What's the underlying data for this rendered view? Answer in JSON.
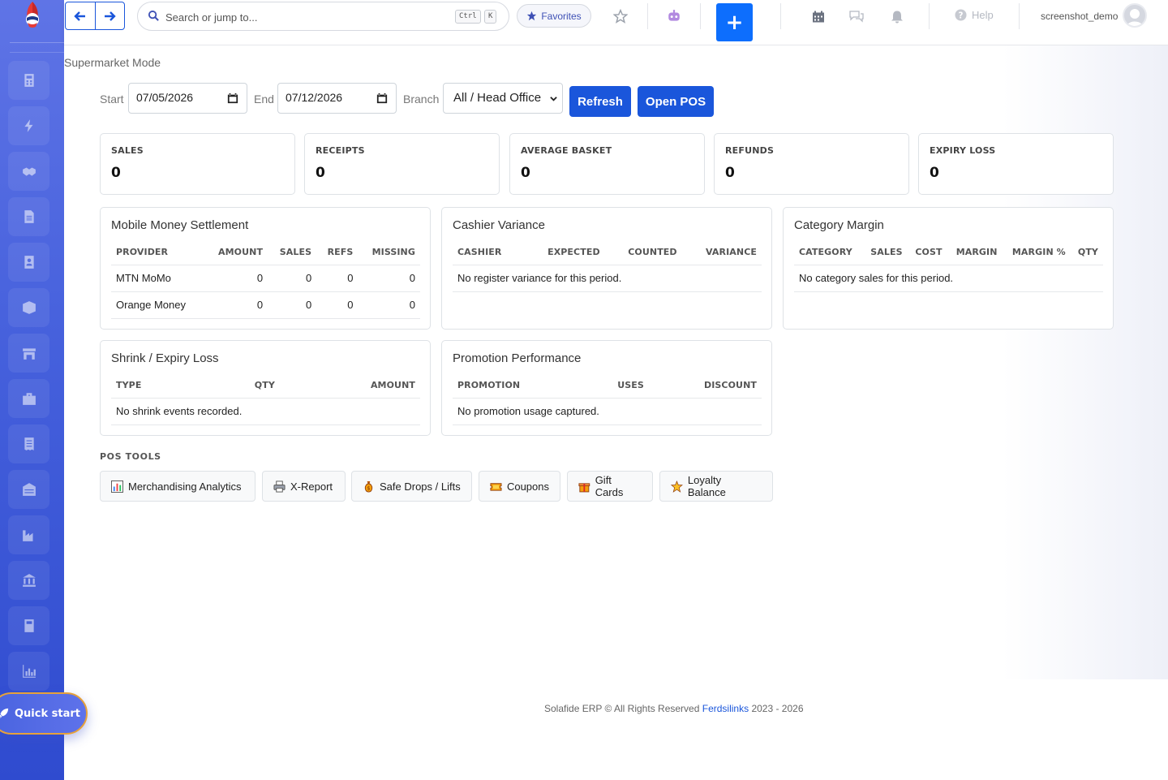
{
  "colors": {
    "primary": "#1a56db",
    "sidebar": "#4560dc",
    "accent_border": "#e6a13a"
  },
  "topbar": {
    "search_placeholder": "Search or jump to...",
    "kbd_ctrl": "Ctrl",
    "kbd_k": "K",
    "favorites_label": "Favorites",
    "plus_label": "+",
    "help_label": "Help",
    "username": "screenshot_demo"
  },
  "sidebar": {
    "items": [
      {
        "icon": "calculator-icon"
      },
      {
        "icon": "bolt-icon"
      },
      {
        "icon": "handshake-icon"
      },
      {
        "icon": "document-icon"
      },
      {
        "icon": "contact-icon"
      },
      {
        "icon": "boxes-icon"
      },
      {
        "icon": "store-icon"
      },
      {
        "icon": "briefcase-icon"
      },
      {
        "icon": "receipt-icon"
      },
      {
        "icon": "warehouse-icon"
      },
      {
        "icon": "factory-icon"
      },
      {
        "icon": "bank-icon"
      },
      {
        "icon": "book-icon"
      },
      {
        "icon": "chart-icon"
      }
    ]
  },
  "page": {
    "title": "Supermarket Mode",
    "filters": {
      "start_label": "Start",
      "start_value": "07/05/2026",
      "end_label": "End",
      "end_value": "07/12/2026",
      "branch_label": "Branch",
      "branch_value": "All / Head Office",
      "refresh_label": "Refresh",
      "open_pos_label": "Open POS"
    },
    "stats": [
      {
        "label": "SALES",
        "value": "0"
      },
      {
        "label": "RECEIPTS",
        "value": "0"
      },
      {
        "label": "AVERAGE BASKET",
        "value": "0"
      },
      {
        "label": "REFUNDS",
        "value": "0"
      },
      {
        "label": "EXPIRY LOSS",
        "value": "0"
      }
    ],
    "mobile_money": {
      "title": "Mobile Money Settlement",
      "headers": [
        "PROVIDER",
        "AMOUNT",
        "SALES",
        "REFS",
        "MISSING"
      ],
      "rows": [
        [
          "MTN MoMo",
          "0",
          "0",
          "0",
          "0"
        ],
        [
          "Orange Money",
          "0",
          "0",
          "0",
          "0"
        ]
      ]
    },
    "cashier_variance": {
      "title": "Cashier Variance",
      "headers": [
        "CASHIER",
        "EXPECTED",
        "COUNTED",
        "VARIANCE"
      ],
      "empty": "No register variance for this period."
    },
    "category_margin": {
      "title": "Category Margin",
      "headers": [
        "CATEGORY",
        "SALES",
        "COST",
        "MARGIN",
        "MARGIN %",
        "QTY"
      ],
      "empty": "No category sales for this period."
    },
    "shrink": {
      "title": "Shrink / Expiry Loss",
      "headers": [
        "TYPE",
        "QTY",
        "AMOUNT"
      ],
      "empty": "No shrink events recorded."
    },
    "promotion": {
      "title": "Promotion Performance",
      "headers": [
        "PROMOTION",
        "USES",
        "DISCOUNT"
      ],
      "empty": "No promotion usage captured."
    },
    "pos_tools": {
      "title": "POS TOOLS",
      "items": [
        {
          "label": "Merchandising Analytics",
          "icon": "bar-chart-icon"
        },
        {
          "label": "X-Report",
          "icon": "printer-icon"
        },
        {
          "label": "Safe Drops / Lifts",
          "icon": "money-bag-icon"
        },
        {
          "label": "Coupons",
          "icon": "ticket-icon"
        },
        {
          "label": "Gift Cards",
          "icon": "gift-icon"
        },
        {
          "label": "Loyalty Balance",
          "icon": "star-icon"
        }
      ]
    }
  },
  "footer": {
    "text": "Solafide ERP © All Rights Reserved",
    "link": "Ferdsilinks",
    "years": "2023 - 2026"
  },
  "quick_start": "Quick start"
}
